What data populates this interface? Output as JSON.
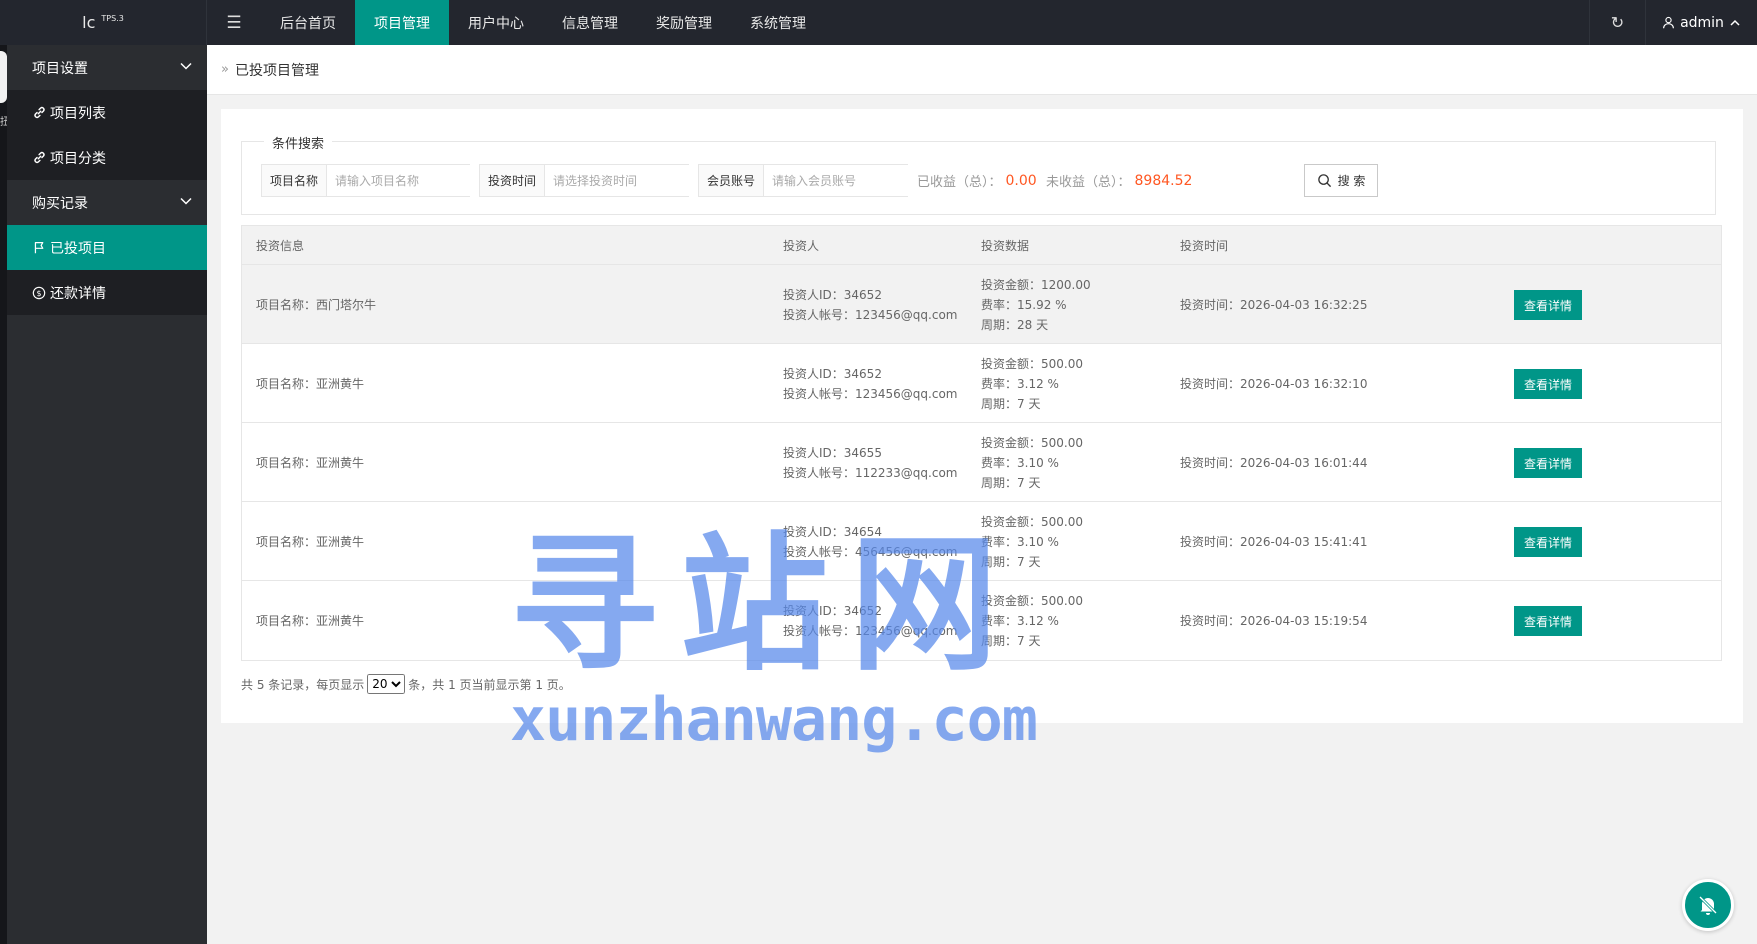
{
  "logo": {
    "text": "lc",
    "version": "TPS.3"
  },
  "topnav": {
    "items": [
      {
        "label": "后台首页"
      },
      {
        "label": "项目管理"
      },
      {
        "label": "用户中心"
      },
      {
        "label": "信息管理"
      },
      {
        "label": "奖励管理"
      },
      {
        "label": "系统管理"
      }
    ],
    "active_index": 1,
    "user": "admin"
  },
  "sidebar": {
    "tab_char": "扭",
    "groups": [
      {
        "label": "项目设置",
        "children": [
          {
            "label": "项目列表",
            "icon": "link-icon"
          },
          {
            "label": "项目分类",
            "icon": "link-icon"
          }
        ]
      },
      {
        "label": "购买记录",
        "children": [
          {
            "label": "已投项目",
            "icon": "flag-icon"
          },
          {
            "label": "还款详情",
            "icon": "dollar-circle-icon"
          }
        ]
      }
    ],
    "active": "已投项目"
  },
  "breadcrumb": {
    "title": "已投项目管理"
  },
  "search": {
    "legend": "条件搜索",
    "fields": [
      {
        "label": "项目名称",
        "placeholder": "请输入项目名称"
      },
      {
        "label": "投资时间",
        "placeholder": "请选择投资时间"
      },
      {
        "label": "会员账号",
        "placeholder": "请输入会员账号"
      }
    ],
    "earned_label": "已收益（总）：",
    "earned_value": "0.00",
    "pending_label": "未收益（总）：",
    "pending_value": "8984.52",
    "button": "搜 索"
  },
  "table": {
    "headers": [
      "投资信息",
      "投资人",
      "投资数据",
      "投资时间"
    ],
    "rows": [
      {
        "project": "项目名称：西门塔尔牛",
        "investor_id": "投资人ID：34652",
        "investor_account": "投资人帐号：123456@qq.com",
        "amount": "投资金额：1200.00",
        "rate": "费率：15.92 %",
        "period": "周期：28 天",
        "time": "投资时间：2026-04-03 16:32:25",
        "action": "查看详情"
      },
      {
        "project": "项目名称：亚洲黄牛",
        "investor_id": "投资人ID：34652",
        "investor_account": "投资人帐号：123456@qq.com",
        "amount": "投资金额：500.00",
        "rate": "费率：3.12 %",
        "period": "周期：7 天",
        "time": "投资时间：2026-04-03 16:32:10",
        "action": "查看详情"
      },
      {
        "project": "项目名称：亚洲黄牛",
        "investor_id": "投资人ID：34655",
        "investor_account": "投资人帐号：112233@qq.com",
        "amount": "投资金额：500.00",
        "rate": "费率：3.10 %",
        "period": "周期：7 天",
        "time": "投资时间：2026-04-03 16:01:44",
        "action": "查看详情"
      },
      {
        "project": "项目名称：亚洲黄牛",
        "investor_id": "投资人ID：34654",
        "investor_account": "投资人帐号：456456@qq.com",
        "amount": "投资金额：500.00",
        "rate": "费率：3.10 %",
        "period": "周期：7 天",
        "time": "投资时间：2026-04-03 15:41:41",
        "action": "查看详情"
      },
      {
        "project": "项目名称：亚洲黄牛",
        "investor_id": "投资人ID：34652",
        "investor_account": "投资人帐号：123456@qq.com",
        "amount": "投资金额：500.00",
        "rate": "费率：3.12 %",
        "period": "周期：7 天",
        "time": "投资时间：2026-04-03 15:19:54",
        "action": "查看详情"
      }
    ]
  },
  "pager": {
    "before": "共 5 条记录，每页显示",
    "page_size": "20",
    "after": "条，共 1 页当前显示第 1 页。"
  },
  "watermark": {
    "cn": "寻站网",
    "en": "xunzhanwang.com"
  },
  "colors": {
    "accent": "#009688",
    "topbar": "#23262e",
    "sidebar": "#2b2d31",
    "value_red": "#ff5722"
  }
}
